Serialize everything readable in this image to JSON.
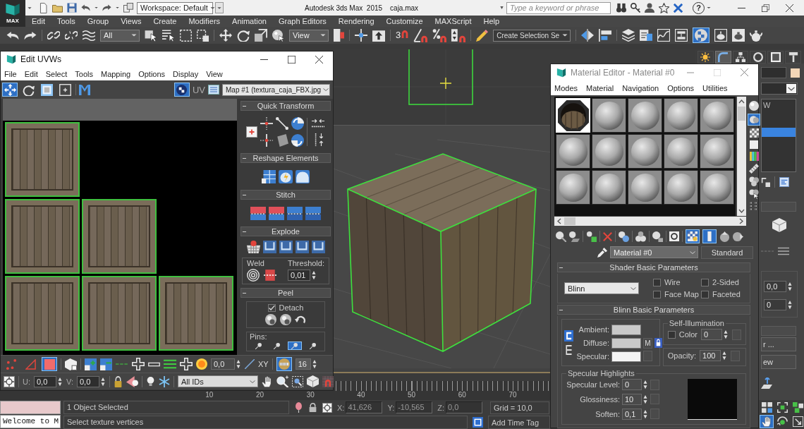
{
  "app": {
    "logo": "MAX",
    "workspace": "Workspace: Default",
    "title": "Autodesk 3ds Max  2015",
    "file": "caja.max",
    "search": {
      "placeholder": "Type a keyword or phrase"
    },
    "help": "?"
  },
  "menu": [
    "Edit",
    "Tools",
    "Group",
    "Views",
    "Create",
    "Modifiers",
    "Animation",
    "Graph Editors",
    "Rendering",
    "Customize",
    "MAXScript",
    "Help"
  ],
  "toolbar": {
    "selection_filter": "All",
    "reference_coordinate": "View",
    "snap_dimension": "3",
    "named_selection": "Create Selection Se",
    "material_editor_active": true
  },
  "command_panel": {
    "tabs": [
      {
        "kind": "create",
        "selected": false
      },
      {
        "kind": "modify",
        "selected": true
      },
      {
        "kind": "hierarchy",
        "selected": false
      },
      {
        "kind": "motion",
        "selected": false
      },
      {
        "kind": "display",
        "selected": false
      },
      {
        "kind": "utilities",
        "selected": false
      }
    ],
    "stack": [
      {
        "label": "W",
        "selected": false
      },
      {
        "selected": true
      }
    ],
    "spinners": [
      "0,0",
      "0"
    ],
    "buttons": [
      "r ...",
      "ew"
    ]
  },
  "uv_editor": {
    "title": "Edit UVWs",
    "menu": [
      "File",
      "Edit",
      "Select",
      "Tools",
      "Mapping",
      "Options",
      "Display",
      "View"
    ],
    "tools": [
      {
        "kind": "move",
        "selected": true
      },
      {
        "kind": "rotate",
        "selected": false
      },
      {
        "kind": "scale",
        "selected": false
      },
      {
        "kind": "freeform",
        "selected": false
      }
    ],
    "checker_on": true,
    "uv_label": "UV",
    "texture": "Map #1 (textura_caja_FBX.jpg",
    "tile_rows": [
      [
        {
          "selected": true
        }
      ],
      [
        {
          "selected": true
        },
        {
          "selected": true
        }
      ],
      [
        {
          "selected": true
        },
        {
          "selected": true
        },
        {
          "selected": true
        }
      ]
    ],
    "rollouts": {
      "quick_transform": "Quick Transform",
      "reshape": "Reshape Elements",
      "stitch": "Stitch",
      "explode": "Explode"
    },
    "weld": {
      "label": "Weld",
      "threshold_label": "Threshold:",
      "threshold": "0,01"
    },
    "peel": {
      "title": "Peel",
      "detach": {
        "label": "Detach",
        "checked": true
      },
      "pins_label": "Pins:",
      "pins": [
        {
          "selected": false
        },
        {
          "selected": false
        },
        {
          "selected": true
        },
        {
          "selected": false
        }
      ]
    },
    "modes": [
      {
        "kind": "vertex",
        "selected": false
      },
      {
        "kind": "edge",
        "selected": false
      },
      {
        "kind": "polygon",
        "selected": true
      }
    ],
    "soft_value": "0,0",
    "axis": "XY",
    "map_display_on": true,
    "brush_size": "16",
    "u_label": "U:",
    "u": "0,0",
    "v_label": "V:",
    "v": "0,0",
    "id_filter": "All IDs"
  },
  "material_editor": {
    "title": "Material Editor - Material #0",
    "menu": [
      "Modes",
      "Material",
      "Navigation",
      "Options",
      "Utilities"
    ],
    "slots": [
      {
        "kind": "textured",
        "selected": true
      },
      {
        "kind": "plain",
        "selected": false
      },
      {
        "kind": "plain",
        "selected": false
      },
      {
        "kind": "plain",
        "selected": false
      },
      {
        "kind": "plain",
        "selected": false
      },
      {
        "kind": "plain",
        "selected": false
      },
      {
        "kind": "plain",
        "selected": false
      },
      {
        "kind": "plain",
        "selected": false
      },
      {
        "kind": "plain",
        "selected": false
      },
      {
        "kind": "plain",
        "selected": false
      },
      {
        "kind": "plain",
        "selected": false
      },
      {
        "kind": "plain",
        "selected": false
      },
      {
        "kind": "plain",
        "selected": false
      },
      {
        "kind": "plain",
        "selected": false
      },
      {
        "kind": "plain",
        "selected": false
      }
    ],
    "backlight_on": true,
    "show_map_on": true,
    "show_end_result_on": true,
    "name": "Material #0",
    "type": "Standard",
    "shader": {
      "title": "Shader Basic Parameters",
      "name": "Blinn",
      "options": [
        {
          "label": "Wire",
          "checked": false
        },
        {
          "label": "2-Sided",
          "checked": false
        },
        {
          "label": "Face Map",
          "checked": false
        },
        {
          "label": "Faceted",
          "checked": false
        }
      ]
    },
    "basic": {
      "title": "Blinn Basic Parameters",
      "colors": [
        {
          "label": "Ambient:",
          "color": "#c9c9c9"
        },
        {
          "label": "Diffuse:",
          "color": "#c9c9c9"
        },
        {
          "label": "Specular:",
          "color": "#f4f4f4"
        }
      ],
      "map_button": "M",
      "self_illum": {
        "title": "Self-Illumination",
        "label": "Color",
        "checked": false,
        "value": "0"
      },
      "opacity_label": "Opacity:",
      "opacity": "100"
    },
    "highlights": {
      "title": "Specular Highlights",
      "fields": [
        {
          "label": "Specular Level:",
          "value": "0"
        },
        {
          "label": "Glossiness:",
          "value": "10"
        },
        {
          "label": "Soften:",
          "value": "0,1"
        }
      ]
    }
  },
  "timeline": {
    "labels": [
      "10",
      "20",
      "30",
      "40",
      "50",
      "60",
      "70"
    ]
  },
  "status": {
    "listener": "Welcome to M",
    "prompt": "1 Object Selected",
    "hint": "Select texture vertices",
    "coords": [
      {
        "label": "X:",
        "value": "41,626"
      },
      {
        "label": "Y:",
        "value": "-10,565"
      },
      {
        "label": "Z:",
        "value": "0,0"
      }
    ],
    "grid": "Grid = 10,0",
    "time_tag": "Add Time Tag"
  },
  "nav": [
    {
      "kind": "layout",
      "selected": false
    },
    {
      "kind": "zoom_extents",
      "selected": false
    },
    {
      "kind": "zoom_extents_all",
      "selected": false
    },
    {
      "kind": "pan",
      "selected": true
    },
    {
      "kind": "orbit",
      "selected": false
    },
    {
      "kind": "maximize",
      "selected": false
    }
  ]
}
